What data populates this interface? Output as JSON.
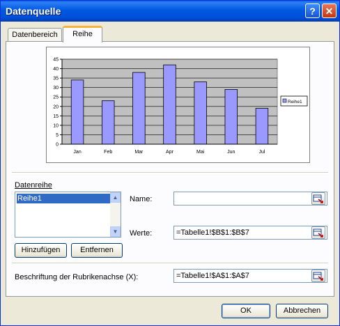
{
  "window": {
    "title": "Datenquelle",
    "help_glyph": "?",
    "close_glyph": "✕"
  },
  "tabs": [
    {
      "label": "Datenbereich"
    },
    {
      "label": "Reihe"
    }
  ],
  "chart_data": {
    "type": "bar",
    "categories": [
      "Jan",
      "Feb",
      "Mar",
      "Apr",
      "Mai",
      "Jun",
      "Jul"
    ],
    "series": [
      {
        "name": "Reihe1",
        "values": [
          34,
          23,
          38,
          42,
          33,
          29,
          19
        ],
        "color": "#9999ff"
      }
    ],
    "yticks": [
      "0",
      "5",
      "10",
      "15",
      "20",
      "25",
      "30",
      "35",
      "40",
      "45"
    ],
    "ylim": [
      0,
      45
    ],
    "grid": true,
    "plot_background": "#c0c0c0",
    "legend_position": "right"
  },
  "series_section": {
    "label": "Datenreihe",
    "items": [
      "Reihe1"
    ],
    "add_button": "Hinzufügen",
    "remove_button": "Entfernen"
  },
  "name_field": {
    "label": "Name:",
    "value": ""
  },
  "values_field": {
    "label": "Werte:",
    "value": "=Tabelle1!$B$1:$B$7"
  },
  "category_axis": {
    "label": "Beschriftung der Rubrikenachse (X):",
    "value": "=Tabelle1!$A$1:$A$7"
  },
  "footer": {
    "ok": "OK",
    "cancel": "Abbrechen"
  }
}
